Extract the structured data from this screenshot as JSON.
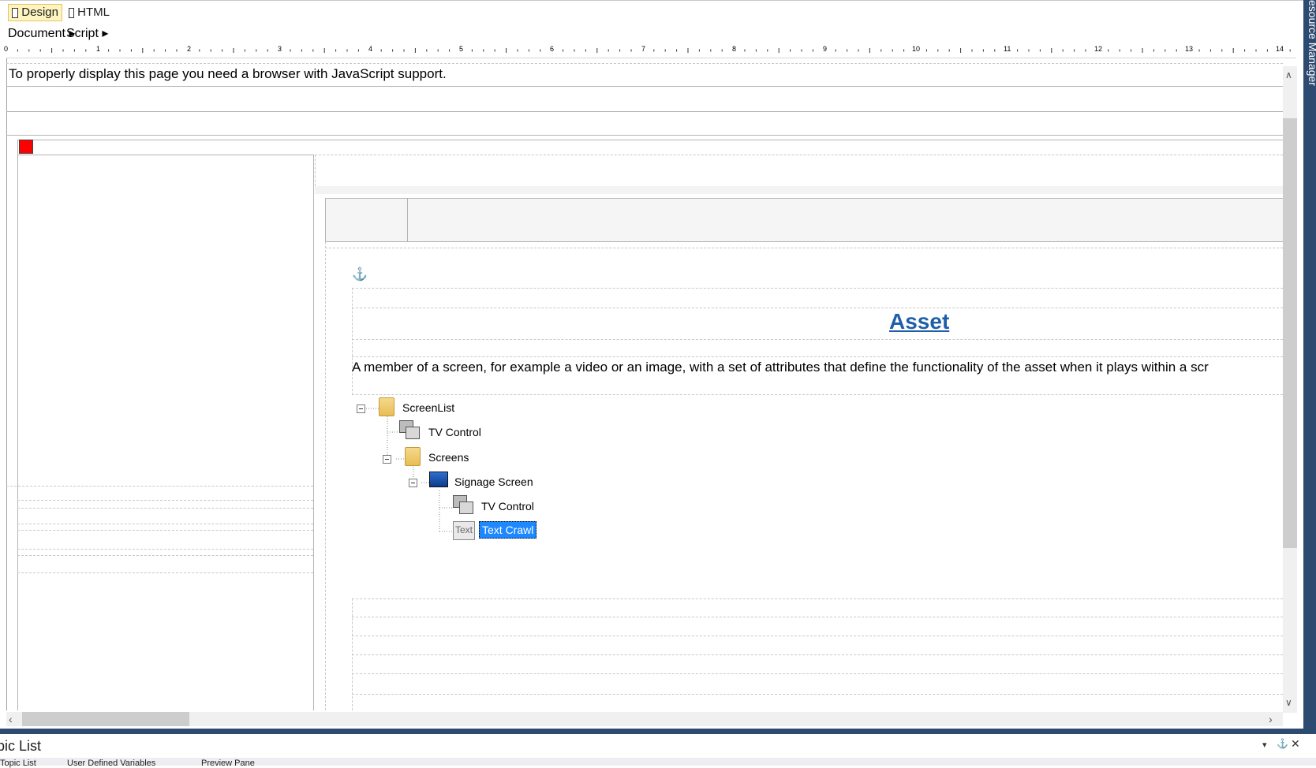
{
  "view_tabs": {
    "design": "Design",
    "html": "HTML"
  },
  "menu": {
    "document": "Document ▸",
    "script": "Script ▸"
  },
  "ruler": {
    "numbers": [
      "0",
      "1",
      "2",
      "3",
      "4",
      "5",
      "6",
      "7",
      "8",
      "9",
      "10",
      "11",
      "12",
      "13",
      "14"
    ]
  },
  "page": {
    "warning": "To properly display this page you need a browser with JavaScript support.",
    "title": "Asset",
    "description": "A member of a screen, for example a video or an image, with a set of attributes that define the functionality of the asset when it plays within a scr"
  },
  "tree": {
    "screenlist": "ScreenList",
    "tv_control_1": "TV Control",
    "screens": "Screens",
    "signage_screen": "Signage Screen",
    "tv_control_2": "TV Control",
    "text_crawl": "Text Crawl",
    "text_icon_glyph": "Text"
  },
  "side": {
    "resource_manager": "esource Manager"
  },
  "bottom_panel": {
    "title": "pic List",
    "tabs": [
      "Topic List",
      "User Defined Variables",
      "Preview Pane"
    ]
  },
  "colors": {
    "accent_blue": "#1f5ea8",
    "selection": "#1e88ff",
    "frame": "#2d4a70",
    "marker": "#ff0000"
  }
}
